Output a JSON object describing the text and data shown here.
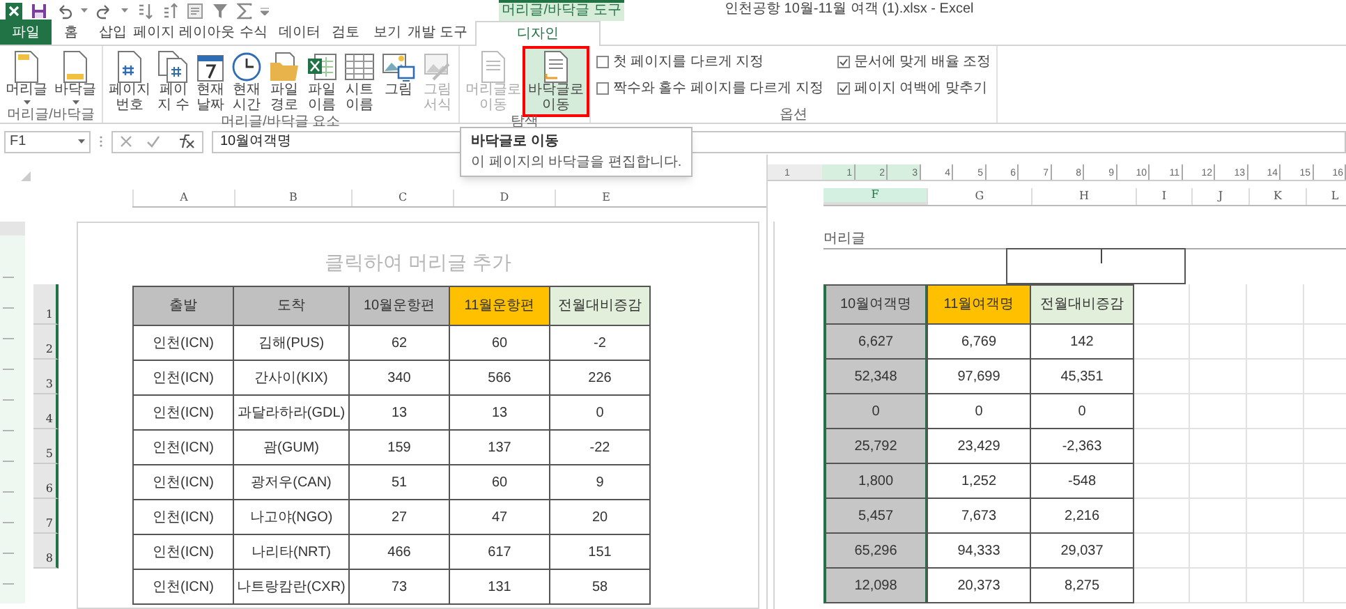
{
  "window": {
    "title": "인천공항 10월-11월 여객 (1).xlsx - Excel"
  },
  "contextual_tab_group": {
    "label": "머리글/바닥글 도구"
  },
  "tabs": [
    {
      "label": "파일",
      "kind": "file",
      "selected": false
    },
    {
      "label": "홈",
      "kind": "tab",
      "selected": false
    },
    {
      "label": "삽입",
      "kind": "tab",
      "selected": false
    },
    {
      "label": "페이지 레이아웃",
      "kind": "tab",
      "selected": false
    },
    {
      "label": "수식",
      "kind": "tab",
      "selected": false
    },
    {
      "label": "데이터",
      "kind": "tab",
      "selected": false
    },
    {
      "label": "검토",
      "kind": "tab",
      "selected": false
    },
    {
      "label": "보기",
      "kind": "tab",
      "selected": false
    },
    {
      "label": "개발 도구",
      "kind": "tab",
      "selected": false
    },
    {
      "label": "디자인",
      "kind": "contextual",
      "selected": true
    }
  ],
  "ribbon": {
    "groups": [
      {
        "label": "머리글/바닥글",
        "buttons": [
          {
            "lines": [
              "머리글"
            ],
            "dropdown": true,
            "disabled": false,
            "highlighted": false,
            "marked": false
          },
          {
            "lines": [
              "바닥글"
            ],
            "dropdown": true,
            "disabled": false,
            "highlighted": false,
            "marked": false
          }
        ]
      },
      {
        "label": "머리글/바닥글 요소",
        "buttons": [
          {
            "lines": [
              "페이지",
              "번호"
            ],
            "dropdown": false,
            "disabled": false,
            "highlighted": false,
            "marked": false
          },
          {
            "lines": [
              "페이",
              "지 수"
            ],
            "dropdown": false,
            "disabled": false,
            "highlighted": false,
            "marked": false
          },
          {
            "lines": [
              "현재",
              "날짜"
            ],
            "dropdown": false,
            "disabled": false,
            "highlighted": false,
            "marked": false
          },
          {
            "lines": [
              "현재",
              "시간"
            ],
            "dropdown": false,
            "disabled": false,
            "highlighted": false,
            "marked": false
          },
          {
            "lines": [
              "파일",
              "경로"
            ],
            "dropdown": false,
            "disabled": false,
            "highlighted": false,
            "marked": false
          },
          {
            "lines": [
              "파일",
              "이름"
            ],
            "dropdown": false,
            "disabled": false,
            "highlighted": false,
            "marked": false
          },
          {
            "lines": [
              "시트",
              "이름"
            ],
            "dropdown": false,
            "disabled": false,
            "highlighted": false,
            "marked": false
          },
          {
            "lines": [
              "그림"
            ],
            "dropdown": false,
            "disabled": false,
            "highlighted": false,
            "marked": false
          },
          {
            "lines": [
              "그림",
              "서식"
            ],
            "dropdown": false,
            "disabled": true,
            "highlighted": false,
            "marked": false
          }
        ]
      },
      {
        "label": "탐색",
        "buttons": [
          {
            "lines": [
              "머리글로",
              "이동"
            ],
            "dropdown": false,
            "disabled": true,
            "highlighted": false,
            "marked": false
          },
          {
            "lines": [
              "바닥글로",
              "이동"
            ],
            "dropdown": false,
            "disabled": false,
            "highlighted": true,
            "marked": true
          }
        ]
      },
      {
        "label": "옵션",
        "checkboxes": [
          {
            "label": "첫 페이지를 다르게 지정",
            "checked": false
          },
          {
            "label": "짝수와 홀수 페이지를 다르게 지정",
            "checked": false
          },
          {
            "label": "문서에 맞게 배율 조정",
            "checked": true
          },
          {
            "label": "페이지 여백에 맞추기",
            "checked": true
          }
        ]
      }
    ]
  },
  "tooltip": {
    "title": "바닥글로 이동",
    "text": "이 페이지의 바닥글을 편집합니다."
  },
  "formula_bar": {
    "name_box": "F1",
    "formula": "10월여객명"
  },
  "left_page": {
    "columns": [
      "A",
      "B",
      "C",
      "D",
      "E"
    ],
    "header_placeholder": "클릭하여 머리글 추가",
    "row_numbers": [
      "1",
      "2",
      "3",
      "4",
      "5",
      "6",
      "7",
      "8"
    ],
    "table": {
      "columns": [
        {
          "label": "출발",
          "color": "#c0c0c0"
        },
        {
          "label": "도착",
          "color": "#c0c0c0"
        },
        {
          "label": "10월운항편",
          "color": "#c0c0c0"
        },
        {
          "label": "11월운항편",
          "color": "#ffc000"
        },
        {
          "label": "전월대비증감",
          "color": "#e2efda"
        }
      ],
      "rows": [
        [
          "인천(ICN)",
          "김해(PUS)",
          "62",
          "60",
          "-2"
        ],
        [
          "인천(ICN)",
          "간사이(KIX)",
          "340",
          "566",
          "226"
        ],
        [
          "인천(ICN)",
          "과달라하라(GDL)",
          "13",
          "13",
          "0"
        ],
        [
          "인천(ICN)",
          "괌(GUM)",
          "159",
          "137",
          "-22"
        ],
        [
          "인천(ICN)",
          "광저우(CAN)",
          "51",
          "60",
          "9"
        ],
        [
          "인천(ICN)",
          "나고야(NGO)",
          "27",
          "47",
          "20"
        ],
        [
          "인천(ICN)",
          "나리타(NRT)",
          "466",
          "617",
          "151"
        ],
        [
          "인천(ICN)",
          "나트랑캄란(CXR)",
          "73",
          "131",
          "58"
        ]
      ]
    }
  },
  "right_page": {
    "ruler": [
      "1",
      "1",
      "2",
      "3",
      "4",
      "5",
      "6",
      "7",
      "8",
      "9",
      "10",
      "11",
      "12",
      "13",
      "14",
      "15",
      "16"
    ],
    "columns": [
      {
        "label": "F",
        "selected": true
      },
      {
        "label": "G",
        "selected": false
      },
      {
        "label": "H",
        "selected": false
      },
      {
        "label": "I",
        "selected": false
      },
      {
        "label": "J",
        "selected": false
      },
      {
        "label": "K",
        "selected": false
      },
      {
        "label": "L",
        "selected": false
      }
    ],
    "header_label": "머리글",
    "table": {
      "columns": [
        {
          "label": "10월여객명",
          "color": "#c0c0c0",
          "selected": true
        },
        {
          "label": "11월여객명",
          "color": "#ffc000",
          "selected": false
        },
        {
          "label": "전월대비증감",
          "color": "#e2efda",
          "selected": false
        }
      ],
      "rows": [
        [
          "6,627",
          "6,769",
          "142"
        ],
        [
          "52,348",
          "97,699",
          "45,351"
        ],
        [
          "0",
          "0",
          "0"
        ],
        [
          "25,792",
          "23,429",
          "-2,363"
        ],
        [
          "1,800",
          "1,252",
          "-548"
        ],
        [
          "5,457",
          "7,673",
          "2,216"
        ],
        [
          "65,296",
          "94,333",
          "29,037"
        ],
        [
          "12,098",
          "20,373",
          "8,275"
        ]
      ]
    }
  }
}
